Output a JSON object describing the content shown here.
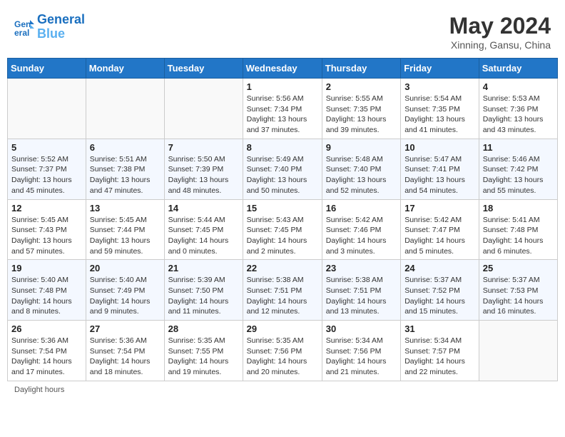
{
  "header": {
    "logo_line1": "General",
    "logo_line2": "Blue",
    "month_year": "May 2024",
    "location": "Xinning, Gansu, China"
  },
  "days_of_week": [
    "Sunday",
    "Monday",
    "Tuesday",
    "Wednesday",
    "Thursday",
    "Friday",
    "Saturday"
  ],
  "footer": {
    "daylight_hours_label": "Daylight hours"
  },
  "weeks": [
    [
      {
        "day": "",
        "sunrise": "",
        "sunset": "",
        "daylight": ""
      },
      {
        "day": "",
        "sunrise": "",
        "sunset": "",
        "daylight": ""
      },
      {
        "day": "",
        "sunrise": "",
        "sunset": "",
        "daylight": ""
      },
      {
        "day": "1",
        "sunrise": "Sunrise: 5:56 AM",
        "sunset": "Sunset: 7:34 PM",
        "daylight": "Daylight: 13 hours and 37 minutes."
      },
      {
        "day": "2",
        "sunrise": "Sunrise: 5:55 AM",
        "sunset": "Sunset: 7:35 PM",
        "daylight": "Daylight: 13 hours and 39 minutes."
      },
      {
        "day": "3",
        "sunrise": "Sunrise: 5:54 AM",
        "sunset": "Sunset: 7:35 PM",
        "daylight": "Daylight: 13 hours and 41 minutes."
      },
      {
        "day": "4",
        "sunrise": "Sunrise: 5:53 AM",
        "sunset": "Sunset: 7:36 PM",
        "daylight": "Daylight: 13 hours and 43 minutes."
      }
    ],
    [
      {
        "day": "5",
        "sunrise": "Sunrise: 5:52 AM",
        "sunset": "Sunset: 7:37 PM",
        "daylight": "Daylight: 13 hours and 45 minutes."
      },
      {
        "day": "6",
        "sunrise": "Sunrise: 5:51 AM",
        "sunset": "Sunset: 7:38 PM",
        "daylight": "Daylight: 13 hours and 47 minutes."
      },
      {
        "day": "7",
        "sunrise": "Sunrise: 5:50 AM",
        "sunset": "Sunset: 7:39 PM",
        "daylight": "Daylight: 13 hours and 48 minutes."
      },
      {
        "day": "8",
        "sunrise": "Sunrise: 5:49 AM",
        "sunset": "Sunset: 7:40 PM",
        "daylight": "Daylight: 13 hours and 50 minutes."
      },
      {
        "day": "9",
        "sunrise": "Sunrise: 5:48 AM",
        "sunset": "Sunset: 7:40 PM",
        "daylight": "Daylight: 13 hours and 52 minutes."
      },
      {
        "day": "10",
        "sunrise": "Sunrise: 5:47 AM",
        "sunset": "Sunset: 7:41 PM",
        "daylight": "Daylight: 13 hours and 54 minutes."
      },
      {
        "day": "11",
        "sunrise": "Sunrise: 5:46 AM",
        "sunset": "Sunset: 7:42 PM",
        "daylight": "Daylight: 13 hours and 55 minutes."
      }
    ],
    [
      {
        "day": "12",
        "sunrise": "Sunrise: 5:45 AM",
        "sunset": "Sunset: 7:43 PM",
        "daylight": "Daylight: 13 hours and 57 minutes."
      },
      {
        "day": "13",
        "sunrise": "Sunrise: 5:45 AM",
        "sunset": "Sunset: 7:44 PM",
        "daylight": "Daylight: 13 hours and 59 minutes."
      },
      {
        "day": "14",
        "sunrise": "Sunrise: 5:44 AM",
        "sunset": "Sunset: 7:45 PM",
        "daylight": "Daylight: 14 hours and 0 minutes."
      },
      {
        "day": "15",
        "sunrise": "Sunrise: 5:43 AM",
        "sunset": "Sunset: 7:45 PM",
        "daylight": "Daylight: 14 hours and 2 minutes."
      },
      {
        "day": "16",
        "sunrise": "Sunrise: 5:42 AM",
        "sunset": "Sunset: 7:46 PM",
        "daylight": "Daylight: 14 hours and 3 minutes."
      },
      {
        "day": "17",
        "sunrise": "Sunrise: 5:42 AM",
        "sunset": "Sunset: 7:47 PM",
        "daylight": "Daylight: 14 hours and 5 minutes."
      },
      {
        "day": "18",
        "sunrise": "Sunrise: 5:41 AM",
        "sunset": "Sunset: 7:48 PM",
        "daylight": "Daylight: 14 hours and 6 minutes."
      }
    ],
    [
      {
        "day": "19",
        "sunrise": "Sunrise: 5:40 AM",
        "sunset": "Sunset: 7:48 PM",
        "daylight": "Daylight: 14 hours and 8 minutes."
      },
      {
        "day": "20",
        "sunrise": "Sunrise: 5:40 AM",
        "sunset": "Sunset: 7:49 PM",
        "daylight": "Daylight: 14 hours and 9 minutes."
      },
      {
        "day": "21",
        "sunrise": "Sunrise: 5:39 AM",
        "sunset": "Sunset: 7:50 PM",
        "daylight": "Daylight: 14 hours and 11 minutes."
      },
      {
        "day": "22",
        "sunrise": "Sunrise: 5:38 AM",
        "sunset": "Sunset: 7:51 PM",
        "daylight": "Daylight: 14 hours and 12 minutes."
      },
      {
        "day": "23",
        "sunrise": "Sunrise: 5:38 AM",
        "sunset": "Sunset: 7:51 PM",
        "daylight": "Daylight: 14 hours and 13 minutes."
      },
      {
        "day": "24",
        "sunrise": "Sunrise: 5:37 AM",
        "sunset": "Sunset: 7:52 PM",
        "daylight": "Daylight: 14 hours and 15 minutes."
      },
      {
        "day": "25",
        "sunrise": "Sunrise: 5:37 AM",
        "sunset": "Sunset: 7:53 PM",
        "daylight": "Daylight: 14 hours and 16 minutes."
      }
    ],
    [
      {
        "day": "26",
        "sunrise": "Sunrise: 5:36 AM",
        "sunset": "Sunset: 7:54 PM",
        "daylight": "Daylight: 14 hours and 17 minutes."
      },
      {
        "day": "27",
        "sunrise": "Sunrise: 5:36 AM",
        "sunset": "Sunset: 7:54 PM",
        "daylight": "Daylight: 14 hours and 18 minutes."
      },
      {
        "day": "28",
        "sunrise": "Sunrise: 5:35 AM",
        "sunset": "Sunset: 7:55 PM",
        "daylight": "Daylight: 14 hours and 19 minutes."
      },
      {
        "day": "29",
        "sunrise": "Sunrise: 5:35 AM",
        "sunset": "Sunset: 7:56 PM",
        "daylight": "Daylight: 14 hours and 20 minutes."
      },
      {
        "day": "30",
        "sunrise": "Sunrise: 5:34 AM",
        "sunset": "Sunset: 7:56 PM",
        "daylight": "Daylight: 14 hours and 21 minutes."
      },
      {
        "day": "31",
        "sunrise": "Sunrise: 5:34 AM",
        "sunset": "Sunset: 7:57 PM",
        "daylight": "Daylight: 14 hours and 22 minutes."
      },
      {
        "day": "",
        "sunrise": "",
        "sunset": "",
        "daylight": ""
      }
    ]
  ]
}
